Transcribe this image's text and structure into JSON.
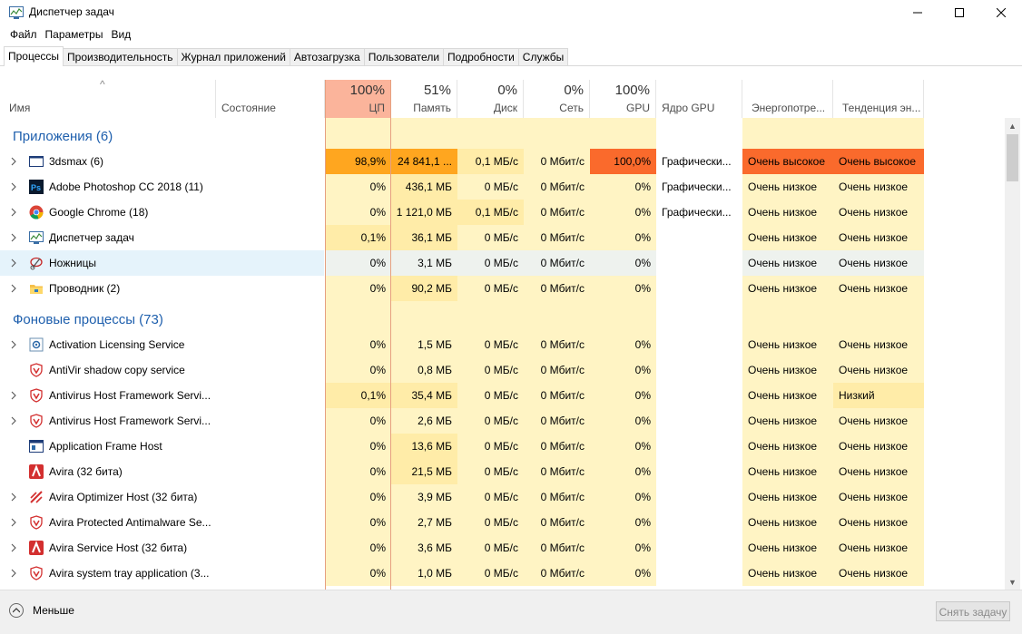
{
  "window": {
    "title": "Диспетчер задач"
  },
  "menu": [
    "Файл",
    "Параметры",
    "Вид"
  ],
  "tabs": [
    "Процессы",
    "Производительность",
    "Журнал приложений",
    "Автозагрузка",
    "Пользователи",
    "Подробности",
    "Службы"
  ],
  "columns": {
    "name": "Имя",
    "status": "Состояние",
    "cpu": {
      "pct": "100%",
      "label": "ЦП"
    },
    "mem": {
      "pct": "51%",
      "label": "Память"
    },
    "disk": {
      "pct": "0%",
      "label": "Диск"
    },
    "net": {
      "pct": "0%",
      "label": "Сеть"
    },
    "gpu": {
      "pct": "100%",
      "label": "GPU"
    },
    "gpu_engine": "Ядро GPU",
    "power": "Энергопотре...",
    "power_trend": "Тенденция эн..."
  },
  "groups": {
    "apps": "Приложения (6)",
    "background": "Фоновые процессы (73)"
  },
  "apps": [
    {
      "name": "3dsmax (6)",
      "icon": "window-icon",
      "cpu": "98,9%",
      "mem": "24 841,1 ...",
      "disk": "0,1 МБ/с",
      "net": "0 Мбит/с",
      "gpu": "100,0%",
      "engine": "Графически...",
      "power": "Очень высокое",
      "trend": "Очень высокое"
    },
    {
      "name": "Adobe Photoshop CC 2018 (11)",
      "icon": "photoshop-icon",
      "cpu": "0%",
      "mem": "436,1 МБ",
      "disk": "0 МБ/с",
      "net": "0 Мбит/с",
      "gpu": "0%",
      "engine": "Графически...",
      "power": "Очень низкое",
      "trend": "Очень низкое"
    },
    {
      "name": "Google Chrome (18)",
      "icon": "chrome-icon",
      "cpu": "0%",
      "mem": "1 121,0 МБ",
      "disk": "0,1 МБ/с",
      "net": "0 Мбит/с",
      "gpu": "0%",
      "engine": "Графически...",
      "power": "Очень низкое",
      "trend": "Очень низкое"
    },
    {
      "name": "Диспетчер задач",
      "icon": "task-manager-icon",
      "cpu": "0,1%",
      "mem": "36,1 МБ",
      "disk": "0 МБ/с",
      "net": "0 Мбит/с",
      "gpu": "0%",
      "engine": "",
      "power": "Очень низкое",
      "trend": "Очень низкое"
    },
    {
      "name": "Ножницы",
      "icon": "snipping-tool-icon",
      "cpu": "0%",
      "mem": "3,1 МБ",
      "disk": "0 МБ/с",
      "net": "0 Мбит/с",
      "gpu": "0%",
      "engine": "",
      "power": "Очень низкое",
      "trend": "Очень низкое"
    },
    {
      "name": "Проводник (2)",
      "icon": "explorer-icon",
      "cpu": "0%",
      "mem": "90,2 МБ",
      "disk": "0 МБ/с",
      "net": "0 Мбит/с",
      "gpu": "0%",
      "engine": "",
      "power": "Очень низкое",
      "trend": "Очень низкое"
    }
  ],
  "background": [
    {
      "name": "Activation Licensing Service",
      "icon": "service-icon",
      "cpu": "0%",
      "mem": "1,5 МБ",
      "disk": "0 МБ/с",
      "net": "0 Мбит/с",
      "gpu": "0%",
      "power": "Очень низкое",
      "trend": "Очень низкое"
    },
    {
      "name": "AntiVir shadow copy service",
      "icon": "avira-shield-icon",
      "cpu": "0%",
      "mem": "0,8 МБ",
      "disk": "0 МБ/с",
      "net": "0 Мбит/с",
      "gpu": "0%",
      "power": "Очень низкое",
      "trend": "Очень низкое"
    },
    {
      "name": "Antivirus Host Framework Servi...",
      "icon": "avira-shield-icon",
      "cpu": "0,1%",
      "mem": "35,4 МБ",
      "disk": "0 МБ/с",
      "net": "0 Мбит/с",
      "gpu": "0%",
      "power": "Очень низкое",
      "trend": "Низкий"
    },
    {
      "name": "Antivirus Host Framework Servi...",
      "icon": "avira-shield-icon",
      "cpu": "0%",
      "mem": "2,6 МБ",
      "disk": "0 МБ/с",
      "net": "0 Мбит/с",
      "gpu": "0%",
      "power": "Очень низкое",
      "trend": "Очень низкое"
    },
    {
      "name": "Application Frame Host",
      "icon": "app-frame-icon",
      "cpu": "0%",
      "mem": "13,6 МБ",
      "disk": "0 МБ/с",
      "net": "0 Мбит/с",
      "gpu": "0%",
      "power": "Очень низкое",
      "trend": "Очень низкое"
    },
    {
      "name": "Avira (32 бита)",
      "icon": "avira-icon",
      "cpu": "0%",
      "mem": "21,5 МБ",
      "disk": "0 МБ/с",
      "net": "0 Мбит/с",
      "gpu": "0%",
      "power": "Очень низкое",
      "trend": "Очень низкое"
    },
    {
      "name": "Avira Optimizer Host (32 бита)",
      "icon": "avira-optimizer-icon",
      "cpu": "0%",
      "mem": "3,9 МБ",
      "disk": "0 МБ/с",
      "net": "0 Мбит/с",
      "gpu": "0%",
      "power": "Очень низкое",
      "trend": "Очень низкое"
    },
    {
      "name": "Avira Protected Antimalware Se...",
      "icon": "avira-shield-icon",
      "cpu": "0%",
      "mem": "2,7 МБ",
      "disk": "0 МБ/с",
      "net": "0 Мбит/с",
      "gpu": "0%",
      "power": "Очень низкое",
      "trend": "Очень низкое"
    },
    {
      "name": "Avira Service Host (32 бита)",
      "icon": "avira-icon",
      "cpu": "0%",
      "mem": "3,6 МБ",
      "disk": "0 МБ/с",
      "net": "0 Мбит/с",
      "gpu": "0%",
      "power": "Очень низкое",
      "trend": "Очень низкое"
    },
    {
      "name": "Avira system tray application (3...",
      "icon": "avira-shield-icon",
      "cpu": "0%",
      "mem": "1,0 МБ",
      "disk": "0 МБ/с",
      "net": "0 Мбит/с",
      "gpu": "0%",
      "power": "Очень низкое",
      "trend": "Очень низкое"
    }
  ],
  "footer": {
    "less": "Меньше",
    "end_task": "Снять задачу"
  },
  "colors": {
    "group": "#1e5fad",
    "cpu_header": "#fbb49b",
    "light": "#fff4c4",
    "medium": "#ffeca8",
    "high": "#ffa61f",
    "very_high": "#fa6a2c"
  }
}
